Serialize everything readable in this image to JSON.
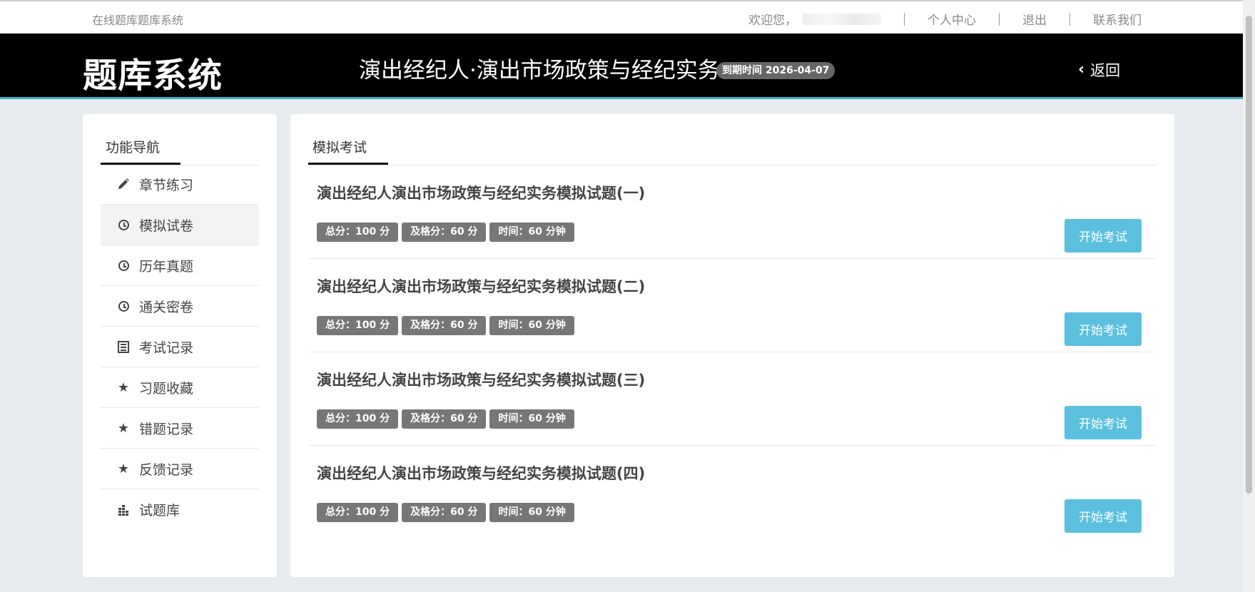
{
  "topbar": {
    "site_name": "在线题库题库系统",
    "welcome": "欢迎您，",
    "links": [
      "个人中心",
      "退出",
      "联系我们"
    ]
  },
  "header": {
    "brand": "题库系统",
    "course_title": "演出经纪人·演出市场政策与经纪实务",
    "expire": "到期时间 2026-04-07",
    "back_label": "返回",
    "background": "#000000",
    "accent_line": "#3bb4cf"
  },
  "sidebar": {
    "title": "功能导航",
    "items": [
      {
        "label": "章节练习",
        "icon": "pencil-icon"
      },
      {
        "label": "模拟试卷",
        "icon": "clock-icon",
        "active": true
      },
      {
        "label": "历年真题",
        "icon": "clock-icon"
      },
      {
        "label": "通关密卷",
        "icon": "clock-icon"
      },
      {
        "label": "考试记录",
        "icon": "list-icon"
      },
      {
        "label": "习题收藏",
        "icon": "star-icon"
      },
      {
        "label": "错题记录",
        "icon": "star-icon"
      },
      {
        "label": "反馈记录",
        "icon": "star-icon"
      },
      {
        "label": "试题库",
        "icon": "bars-icon"
      }
    ]
  },
  "main": {
    "title": "模拟考试",
    "button_color": "#5bc0de",
    "exams": [
      {
        "title": "演出经纪人演出市场政策与经纪实务模拟试题(一)",
        "total": "总分：100 分",
        "pass": "及格分：60 分",
        "time": "时间：60 分钟",
        "button": "开始考试"
      },
      {
        "title": "演出经纪人演出市场政策与经纪实务模拟试题(二)",
        "total": "总分：100 分",
        "pass": "及格分：60 分",
        "time": "时间：60 分钟",
        "button": "开始考试"
      },
      {
        "title": "演出经纪人演出市场政策与经纪实务模拟试题(三)",
        "total": "总分：100 分",
        "pass": "及格分：60 分",
        "time": "时间：60 分钟",
        "button": "开始考试"
      },
      {
        "title": "演出经纪人演出市场政策与经纪实务模拟试题(四)",
        "total": "总分：100 分",
        "pass": "及格分：60 分",
        "time": "时间：60 分钟",
        "button": "开始考试"
      }
    ]
  }
}
